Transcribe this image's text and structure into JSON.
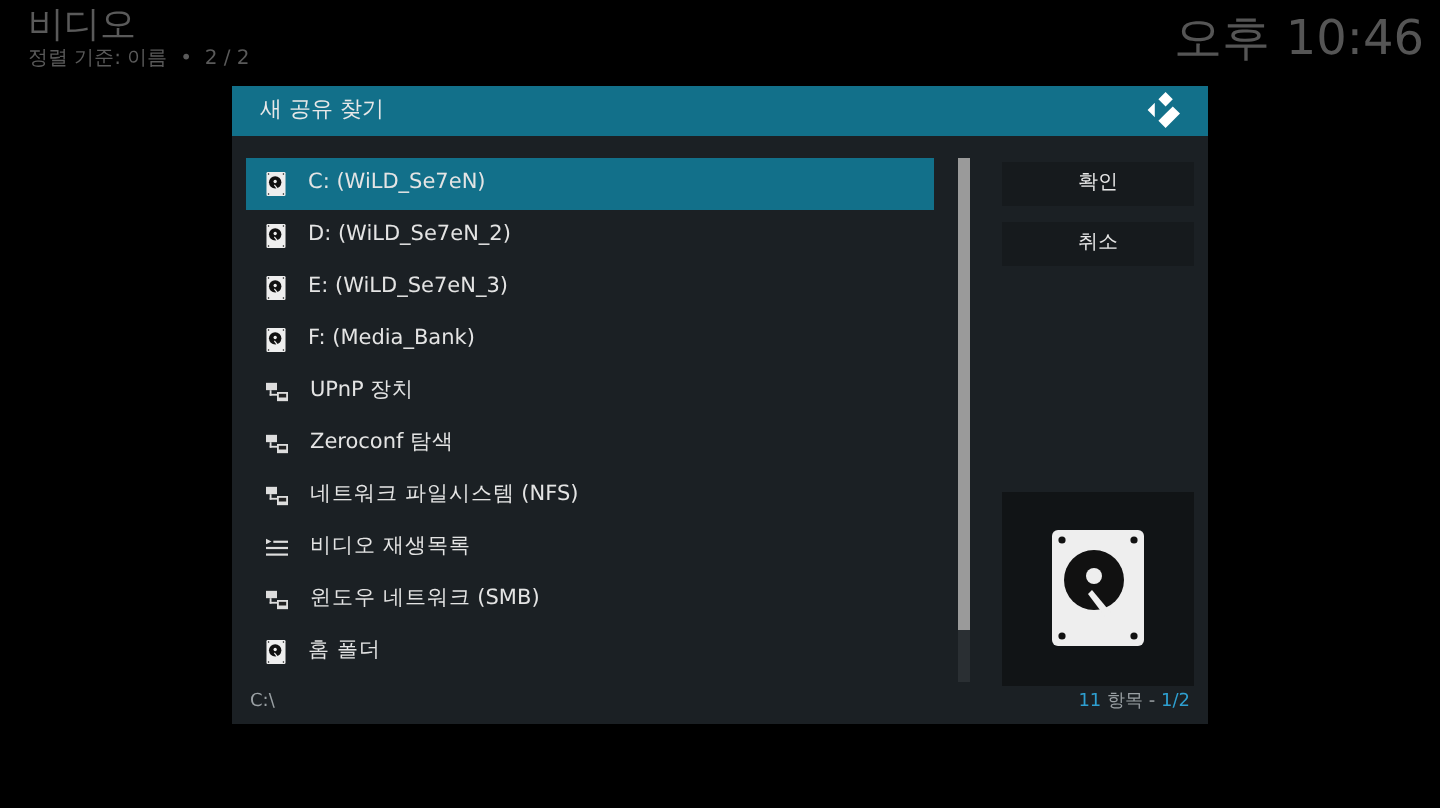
{
  "background": {
    "title": "비디오",
    "subtitle": "정렬 기준: 이름  •  2 / 2",
    "clock": "오후 10:46"
  },
  "dialog": {
    "title": "새 공유 찾기",
    "items": [
      {
        "label": "C: (WiLD_Se7eN)",
        "kind": "drive",
        "selected": true
      },
      {
        "label": "D: (WiLD_Se7eN_2)",
        "kind": "drive",
        "selected": false
      },
      {
        "label": "E: (WiLD_Se7eN_3)",
        "kind": "drive",
        "selected": false
      },
      {
        "label": "F: (Media_Bank)",
        "kind": "drive",
        "selected": false
      },
      {
        "label": "UPnP 장치",
        "kind": "network",
        "selected": false
      },
      {
        "label": "Zeroconf 탐색",
        "kind": "network",
        "selected": false
      },
      {
        "label": "네트워크 파일시스템 (NFS)",
        "kind": "network",
        "selected": false
      },
      {
        "label": "비디오 재생목록",
        "kind": "playlist",
        "selected": false
      },
      {
        "label": "윈도우 네트워크 (SMB)",
        "kind": "network",
        "selected": false
      },
      {
        "label": "홈 폴더",
        "kind": "drive",
        "selected": false
      }
    ],
    "buttons": [
      "확인",
      "취소"
    ],
    "footer": {
      "path": "C:\\",
      "count": "11",
      "count_label": "항목",
      "separator": "-",
      "page": "1/2"
    }
  }
}
